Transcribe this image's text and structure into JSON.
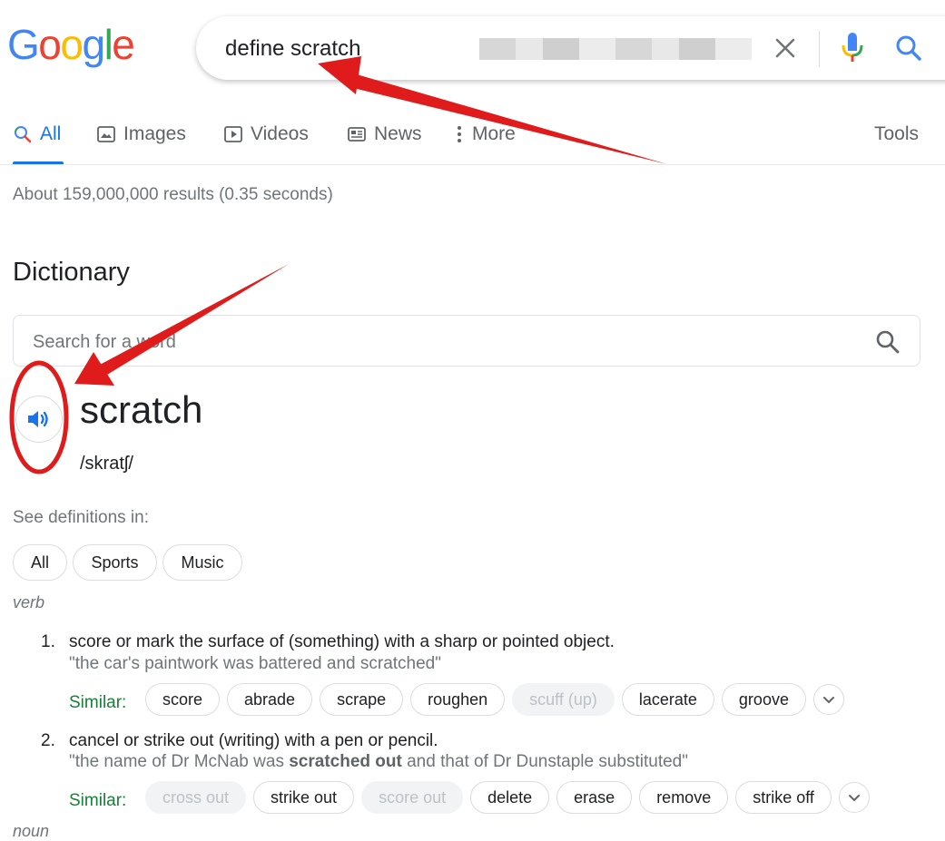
{
  "logo": {
    "text": [
      "G",
      "o",
      "o",
      "g",
      "l",
      "e"
    ],
    "colors": [
      "#4285f4",
      "#ea4335",
      "#fbbc05",
      "#4285f4",
      "#34a853",
      "#ea4335"
    ]
  },
  "search": {
    "query": "define scratch"
  },
  "icons": {
    "clear": "close-icon",
    "mic": "mic-icon",
    "search": "search-icon"
  },
  "tabs": [
    {
      "label": "All",
      "icon": "search-icon",
      "active": true
    },
    {
      "label": "Images",
      "icon": "image-icon"
    },
    {
      "label": "Videos",
      "icon": "play-icon"
    },
    {
      "label": "News",
      "icon": "news-icon"
    },
    {
      "label": "More",
      "icon": "more-vert-icon"
    }
  ],
  "tools_label": "Tools",
  "stats": "About 159,000,000 results (0.35 seconds)",
  "dictionary": {
    "heading": "Dictionary",
    "search_placeholder": "Search for a word",
    "word": "scratch",
    "phonetic": "/skratʃ/",
    "see_definitions": "See definitions in:",
    "filters": [
      "All",
      "Sports",
      "Music"
    ],
    "part_of_speech": "verb",
    "next_part_of_speech": "noun",
    "similar_label": "Similar:",
    "definitions": [
      {
        "num": "1.",
        "text": "score or mark the surface of (something) with a sharp or pointed object.",
        "example": "\"the car's paintwork was battered and scratched\"",
        "similar": [
          {
            "label": "score"
          },
          {
            "label": "abrade"
          },
          {
            "label": "scrape"
          },
          {
            "label": "roughen"
          },
          {
            "label": "scuff (up)",
            "dim": true
          },
          {
            "label": "lacerate"
          },
          {
            "label": "groove"
          }
        ]
      },
      {
        "num": "2.",
        "text": "cancel or strike out (writing) with a pen or pencil.",
        "example_before": "\"the name of Dr McNab was ",
        "example_bold": "scratched out",
        "example_after": " and that of Dr Dunstaple substituted\"",
        "similar": [
          {
            "label": "cross out",
            "dim": true
          },
          {
            "label": "strike out"
          },
          {
            "label": "score out",
            "dim": true
          },
          {
            "label": "delete"
          },
          {
            "label": "erase"
          },
          {
            "label": "remove"
          },
          {
            "label": "strike off"
          }
        ]
      }
    ]
  },
  "annotation_color": "#e01b1b"
}
